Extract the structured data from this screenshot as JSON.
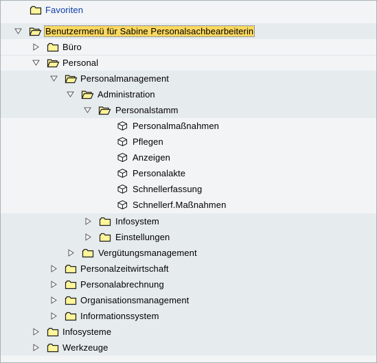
{
  "tree": {
    "favorites": "Favoriten",
    "root": "Benutzermenü für Sabine Personalsachbearbeiterin",
    "buero": "Büro",
    "personal": "Personal",
    "personalmanagement": "Personalmanagement",
    "administration": "Administration",
    "personalstamm": "Personalstamm",
    "personalmassnahmen": "Personalmaßnahmen",
    "pflegen": "Pflegen",
    "anzeigen": "Anzeigen",
    "personalakte": "Personalakte",
    "schnellerfassung": "Schnellerfassung",
    "schnellerf_massnahmen": "Schnellerf.Maßnahmen",
    "infosystem": "Infosystem",
    "einstellungen": "Einstellungen",
    "verguetungsmanagement": "Vergütungsmanagement",
    "personalzeitwirtschaft": "Personalzeitwirtschaft",
    "personalabrechnung": "Personalabrechnung",
    "organisationsmanagement": "Organisationsmanagement",
    "informationssystem": "Informationssystem",
    "infosysteme": "Infosysteme",
    "werkzeuge": "Werkzeuge"
  },
  "icons": {
    "folder_closed": "folder-icon",
    "folder_open": "folder-open-icon",
    "transaction": "transaction-cube-icon",
    "expanded": "triangle-down-icon",
    "collapsed": "triangle-right-icon"
  },
  "colors": {
    "folder_fill": "#fff59a",
    "selection": "#fbd85f",
    "link": "#103da6"
  }
}
